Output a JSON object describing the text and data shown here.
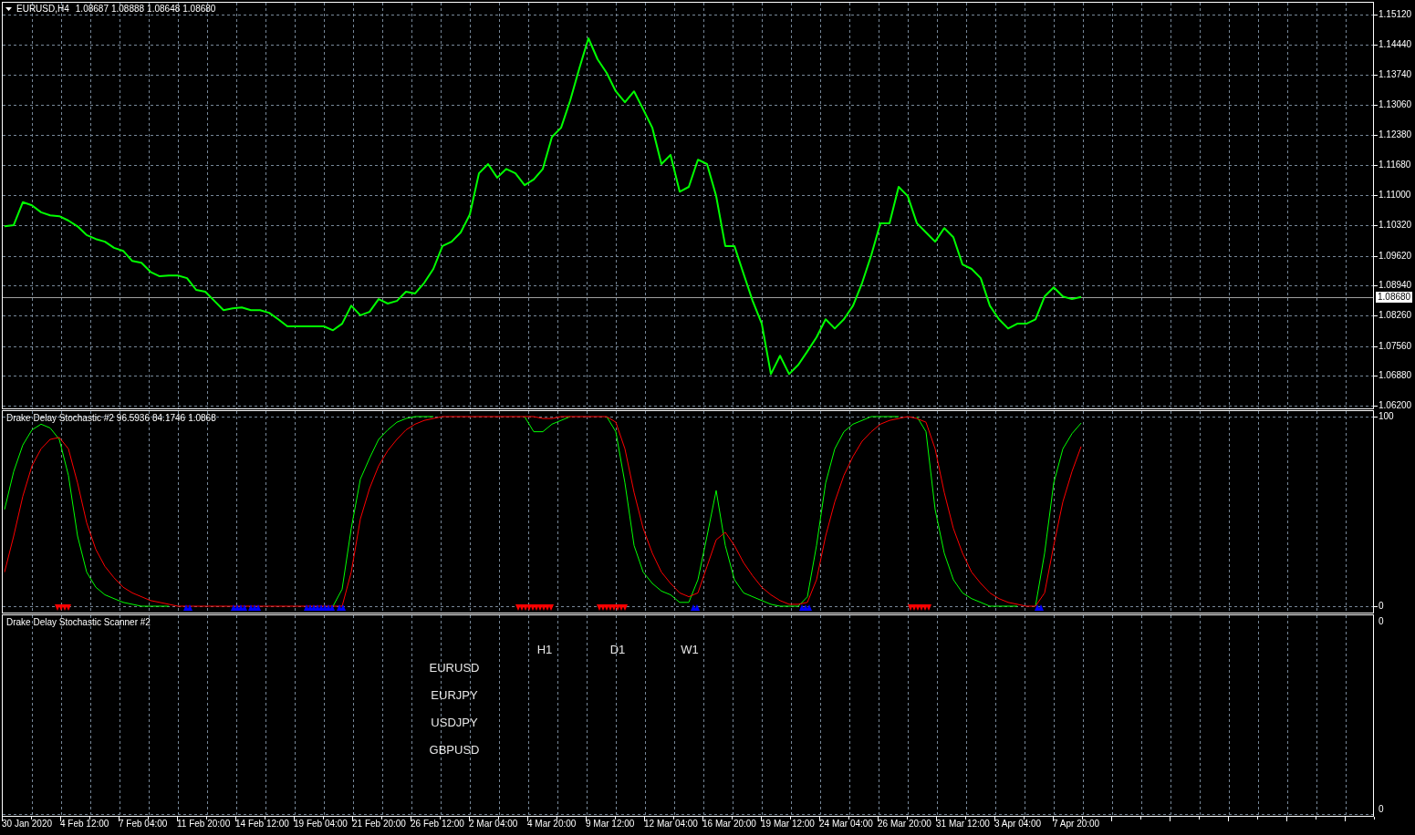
{
  "price_chart": {
    "header": {
      "symbol": "EURUSD,H4",
      "values": [
        "1.08687",
        "1.08888",
        "1.08648",
        "1.08680"
      ]
    },
    "chart_data": {
      "type": "line",
      "categories": [
        null,
        null,
        null,
        null,
        null,
        null,
        null,
        null,
        null,
        null,
        null,
        null,
        null,
        null,
        null,
        null,
        null,
        null,
        null,
        null,
        null,
        null,
        null,
        null,
        null,
        null,
        null,
        null,
        null,
        null,
        null,
        null,
        null,
        null,
        null,
        null,
        null,
        null,
        null,
        null,
        null,
        null,
        null,
        null,
        null,
        null,
        null,
        null,
        null,
        null,
        null,
        null,
        null,
        null,
        null,
        null,
        null,
        null,
        null,
        null,
        null,
        null,
        null,
        null,
        null,
        null,
        null,
        null,
        null,
        null,
        null,
        null,
        null,
        null,
        null,
        null,
        null,
        null,
        null,
        null,
        null,
        null,
        null,
        null,
        null,
        null,
        null,
        null,
        null,
        null,
        null,
        null,
        null,
        null,
        null,
        null,
        null,
        null,
        null,
        null,
        null,
        null,
        null,
        null,
        null,
        null,
        null,
        null,
        null,
        null,
        null,
        null,
        null,
        null,
        null,
        null,
        null,
        null,
        null
      ],
      "series": [
        {
          "color": "#00ff00",
          "values": [
            1.1029,
            1.1032,
            1.1084,
            1.1077,
            1.1061,
            1.1054,
            1.1052,
            1.1042,
            1.1029,
            1.1009,
            1.1,
            1.0994,
            1.098,
            1.0973,
            1.095,
            1.0946,
            1.0925,
            1.0915,
            1.0917,
            1.0917,
            1.0911,
            1.0884,
            1.088,
            1.0859,
            1.0838,
            1.0842,
            1.0844,
            1.0838,
            1.0838,
            1.0832,
            1.0817,
            1.0801,
            1.0801,
            1.0801,
            1.0801,
            1.0801,
            1.0792,
            1.0807,
            1.0848,
            1.0826,
            1.0834,
            1.0863,
            1.0853,
            1.0859,
            1.088,
            1.0876,
            1.09,
            1.0932,
            1.0984,
            1.0994,
            1.1015,
            1.1056,
            1.115,
            1.1171,
            1.114,
            1.116,
            1.115,
            1.1123,
            1.1136,
            1.116,
            1.1233,
            1.1254,
            1.1316,
            1.1389,
            1.1458,
            1.141,
            1.1379,
            1.1337,
            1.1312,
            1.1337,
            1.1296,
            1.1254,
            1.1171,
            1.1192,
            1.1108,
            1.1119,
            1.1181,
            1.1171,
            1.1098,
            1.0984,
            1.0984,
            1.0921,
            1.0859,
            1.0807,
            1.0692,
            1.0734,
            1.0692,
            1.0713,
            1.0744,
            1.0776,
            1.0817,
            1.0796,
            1.0817,
            1.0848,
            1.09,
            1.0963,
            1.1036,
            1.1036,
            1.1119,
            1.1098,
            1.1036,
            1.1015,
            1.0994,
            1.1025,
            1.1004,
            1.0942,
            1.0932,
            1.0911,
            1.0848,
            1.0817,
            1.0796,
            1.0807,
            1.0807,
            1.0817,
            1.0869,
            1.089,
            1.0869,
            1.0863,
            1.0868
          ]
        }
      ],
      "ylim": [
        1.06138,
        1.1539
      ],
      "yticks": [
        {
          "value": 1.1512,
          "label": "1.15120"
        },
        {
          "value": 1.1444,
          "label": "1.14440"
        },
        {
          "value": 1.1374,
          "label": "1.13740"
        },
        {
          "value": 1.1306,
          "label": "1.13060"
        },
        {
          "value": 1.1238,
          "label": "1.12380"
        },
        {
          "value": 1.1168,
          "label": "1.11680"
        },
        {
          "value": 1.11,
          "label": "1.11000"
        },
        {
          "value": 1.1032,
          "label": "1.10320"
        },
        {
          "value": 1.0962,
          "label": "1.09620"
        },
        {
          "value": 1.0894,
          "label": "1.08940"
        },
        {
          "value": 1.0826,
          "label": "1.08260"
        },
        {
          "value": 1.0756,
          "label": "1.07560"
        },
        {
          "value": 1.0688,
          "label": "1.06880"
        },
        {
          "value": 1.062,
          "label": "1.06200"
        }
      ],
      "grid": true,
      "ref_lines": [
        {
          "axis": "y",
          "value": 1.0868,
          "label": "1.08680"
        }
      ]
    }
  },
  "indicator": {
    "header": {
      "title": "Drake Delay Stochastic #2",
      "values": [
        "96.5936",
        "84.1746",
        "1.0868"
      ]
    },
    "chart_data": {
      "type": "line",
      "categories": [
        null,
        null,
        null,
        null,
        null,
        null,
        null,
        null,
        null,
        null,
        null,
        null,
        null,
        null,
        null,
        null,
        null,
        null,
        null,
        null,
        null,
        null,
        null,
        null,
        null,
        null,
        null,
        null,
        null,
        null,
        null,
        null,
        null,
        null,
        null,
        null,
        null,
        null,
        null,
        null,
        null,
        null,
        null,
        null,
        null,
        null,
        null,
        null,
        null,
        null,
        null,
        null,
        null,
        null,
        null,
        null,
        null,
        null,
        null,
        null,
        null,
        null,
        null,
        null,
        null,
        null,
        null,
        null,
        null,
        null,
        null,
        null,
        null,
        null,
        null,
        null,
        null,
        null,
        null,
        null,
        null,
        null,
        null,
        null,
        null,
        null,
        null,
        null,
        null,
        null,
        null,
        null,
        null,
        null,
        null,
        null,
        null,
        null,
        null,
        null,
        null,
        null,
        null,
        null,
        null,
        null,
        null,
        null,
        null,
        null,
        null,
        null,
        null,
        null,
        null,
        null,
        null,
        null,
        null
      ],
      "series": [
        {
          "color": "#00ff00",
          "values": [
            51,
            71,
            85,
            93,
            96,
            94,
            88,
            69,
            37,
            18,
            10,
            6,
            4,
            2,
            1,
            0,
            0,
            0,
            0,
            null,
            null,
            null,
            null,
            null,
            null,
            null,
            null,
            null,
            null,
            null,
            null,
            null,
            null,
            null,
            null,
            null,
            0,
            9,
            41,
            67,
            78,
            88,
            93,
            97,
            99,
            100,
            100,
            100,
            null,
            null,
            null,
            null,
            null,
            null,
            null,
            null,
            null,
            100,
            92,
            92,
            96,
            98,
            100,
            null,
            null,
            null,
            100,
            92,
            65,
            32,
            18,
            12,
            8,
            6,
            2,
            2,
            14,
            37,
            61,
            32,
            14,
            7,
            5,
            3,
            1,
            0,
            0,
            0,
            5,
            32,
            65,
            83,
            92,
            96,
            98,
            100,
            100,
            100,
            100,
            null,
            100,
            92,
            51,
            28,
            14,
            7,
            4,
            2,
            0,
            0,
            0,
            0,
            null,
            0,
            28,
            65,
            83,
            91,
            96.6
          ]
        },
        {
          "color": "#ff0000",
          "values": [
            18,
            37,
            58,
            74,
            83,
            88,
            89,
            83,
            65,
            44,
            30,
            21,
            15,
            10,
            7,
            5,
            3,
            2,
            1,
            0,
            0,
            0,
            0,
            0,
            0,
            0,
            0,
            0,
            0,
            0,
            0,
            0,
            0,
            0,
            0,
            0,
            0,
            0,
            18,
            46,
            62,
            74,
            82,
            88,
            93,
            96,
            98,
            99,
            100,
            100,
            100,
            100,
            100,
            100,
            100,
            100,
            100,
            100,
            100,
            99,
            99,
            100,
            100,
            100,
            100,
            100,
            100,
            97,
            83,
            60,
            41,
            28,
            18,
            12,
            7,
            5,
            7,
            21,
            35,
            39,
            32,
            23,
            16,
            10,
            6,
            3,
            1,
            1,
            2,
            14,
            37,
            55,
            69,
            79,
            87,
            92,
            96,
            98,
            99,
            100,
            99,
            97,
            83,
            60,
            41,
            28,
            18,
            12,
            7,
            4,
            2,
            1,
            0,
            0,
            7,
            32,
            55,
            71,
            84.2
          ]
        }
      ],
      "ylim": [
        -3.37,
        102.88
      ],
      "yticks": [
        {
          "value": 100,
          "label": "100"
        },
        {
          "value": 0,
          "label": "0"
        }
      ],
      "grid": true
    }
  },
  "scanner": {
    "title": "Drake Delay Stochastic Scanner #2",
    "timeframes": [
      "H1",
      "D1",
      "W1"
    ],
    "symbols": [
      "EURUSD",
      "EURJPY",
      "USDJPY",
      "GBPUSD"
    ],
    "axis_labels": [
      "0",
      "0"
    ]
  },
  "time_axis": {
    "labels": [
      "30 Jan 2020",
      "4 Feb 12:00",
      "7 Feb 04:00",
      "11 Feb 20:00",
      "14 Feb 12:00",
      "19 Feb 04:00",
      "21 Feb 20:00",
      "26 Feb 12:00",
      "2 Mar 04:00",
      "4 Mar 20:00",
      "9 Mar 12:00",
      "12 Mar 04:00",
      "16 Mar 20:00",
      "19 Mar 12:00",
      "24 Mar 04:00",
      "26 Mar 20:00",
      "31 Mar 12:00",
      "3 Apr 04:00",
      "7 Apr 20:00"
    ]
  }
}
